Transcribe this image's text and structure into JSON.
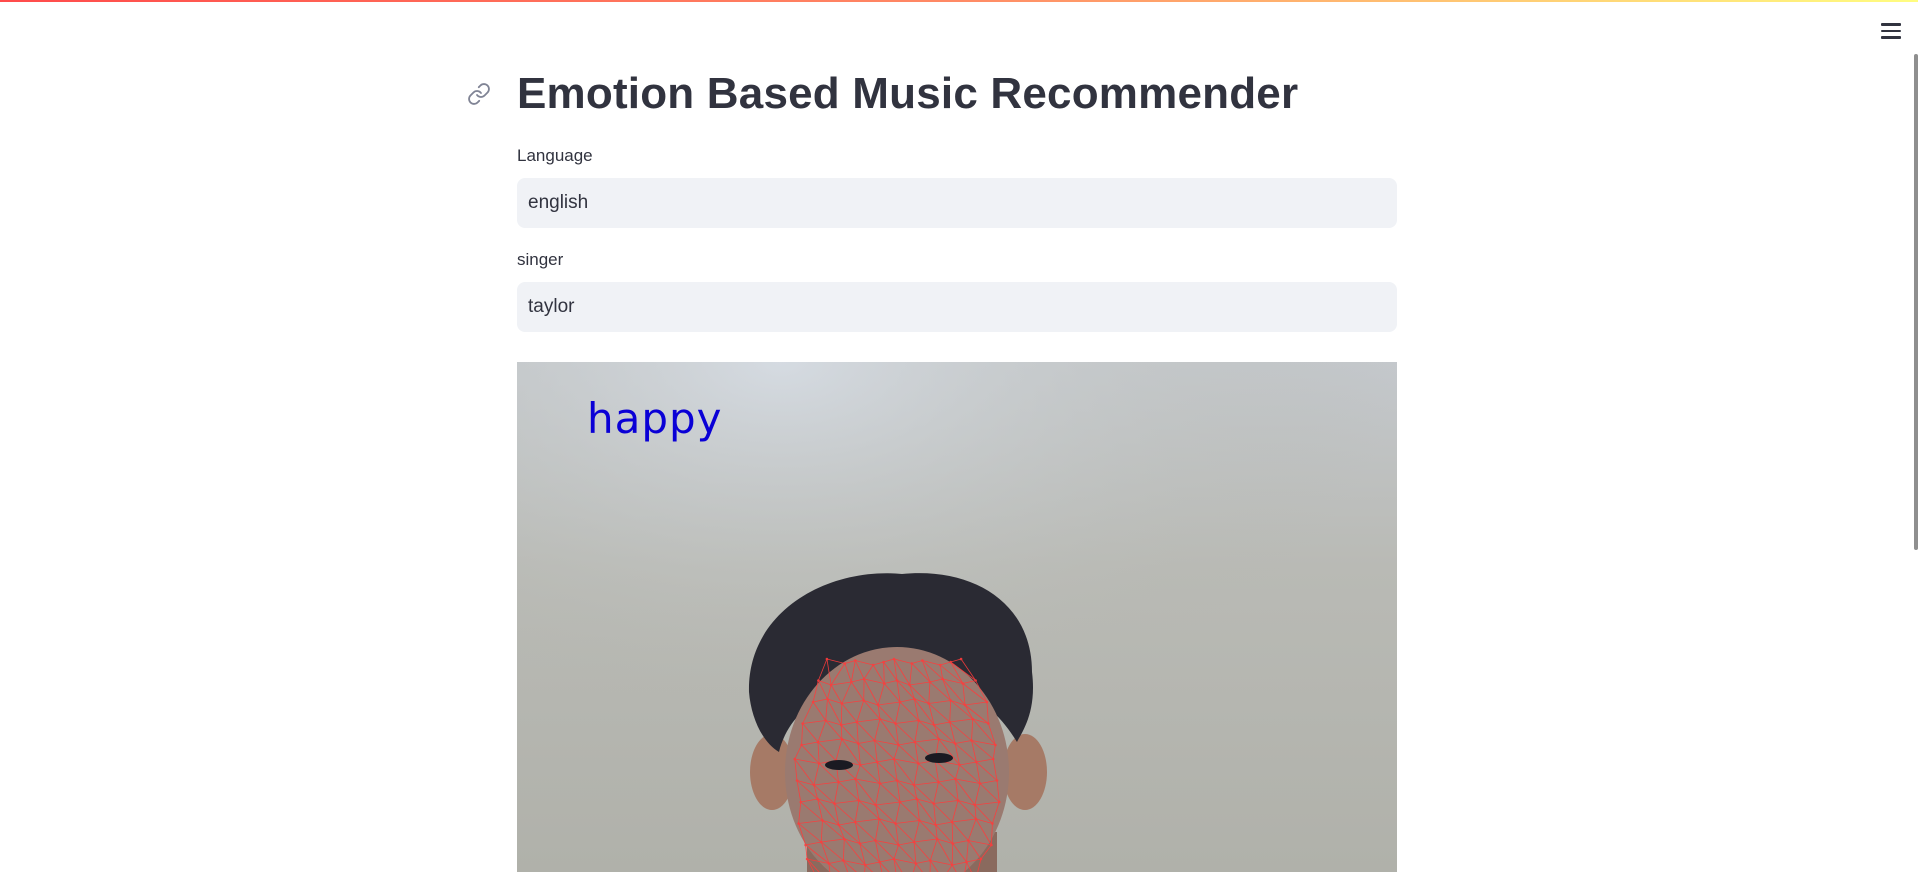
{
  "app": {
    "title": "Emotion Based Music Recommender"
  },
  "fields": [
    {
      "label": "Language",
      "value": "english"
    },
    {
      "label": "singer",
      "value": "taylor"
    }
  ],
  "video": {
    "emotion": "happy"
  },
  "icons": {
    "menu": "hamburger-menu-icon",
    "anchor": "link-icon"
  },
  "colors": {
    "accent": "#ff4b4b",
    "emotion_text": "#0a00d6",
    "mesh": "#ff3b3b"
  }
}
